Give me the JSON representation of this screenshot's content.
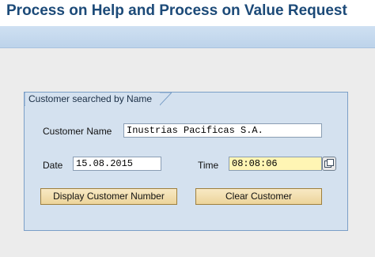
{
  "window": {
    "title": "Process on Help and Process on Value Request"
  },
  "groupbox": {
    "title": "Customer searched by Name"
  },
  "form": {
    "customer_name_label": "Customer Name",
    "customer_name_value": "Inustrias Pacificas S.A.",
    "date_label": "Date",
    "date_value": "15.08.2015",
    "time_label": "Time",
    "time_value": "08:08:06",
    "time_help_icon": "value-help-icon"
  },
  "buttons": {
    "display_customer_number": "Display Customer Number",
    "clear_customer": "Clear Customer"
  },
  "colors": {
    "title": "#1c4a78",
    "toolbar": "#c6d9ee",
    "groupbox_bg": "#d4e1ef",
    "groupbox_border": "#7b9fc7",
    "required_field": "#fff5b4",
    "button": "#f2dca8"
  }
}
